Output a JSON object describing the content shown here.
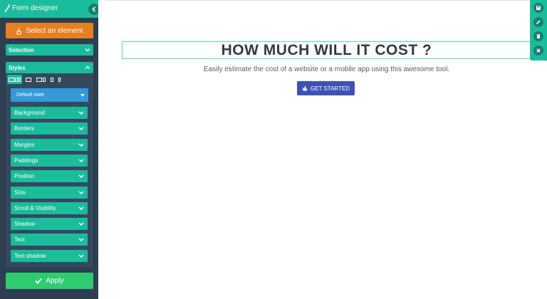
{
  "sidebar": {
    "title": "Form designer",
    "select_button": "Select an element",
    "sections": {
      "selection": "Selection",
      "styles": "Styles"
    },
    "state_select": "Default state",
    "properties": [
      "Background",
      "Borders",
      "Margins",
      "Paddings",
      "Position",
      "Size",
      "Scroll & Visibility",
      "Shadow",
      "Text",
      "Text shadow"
    ],
    "apply_button": "Apply"
  },
  "main": {
    "headline": "HOW MUCH WILL IT COST ?",
    "subtitle": "Easily estimate the cost of a website or a mobile app using this awesome tool.",
    "cta_button": "GET STARTED"
  },
  "toolbar": {
    "icons": [
      "save-icon",
      "pencil-icon",
      "trash-icon",
      "close-icon"
    ]
  },
  "colors": {
    "teal": "#1abc9c",
    "sidebar_bg": "#2c3e50",
    "orange": "#e67e22",
    "blue_state": "#3498db",
    "apply_green": "#2ecc71",
    "cta_indigo": "#3f51b5"
  }
}
